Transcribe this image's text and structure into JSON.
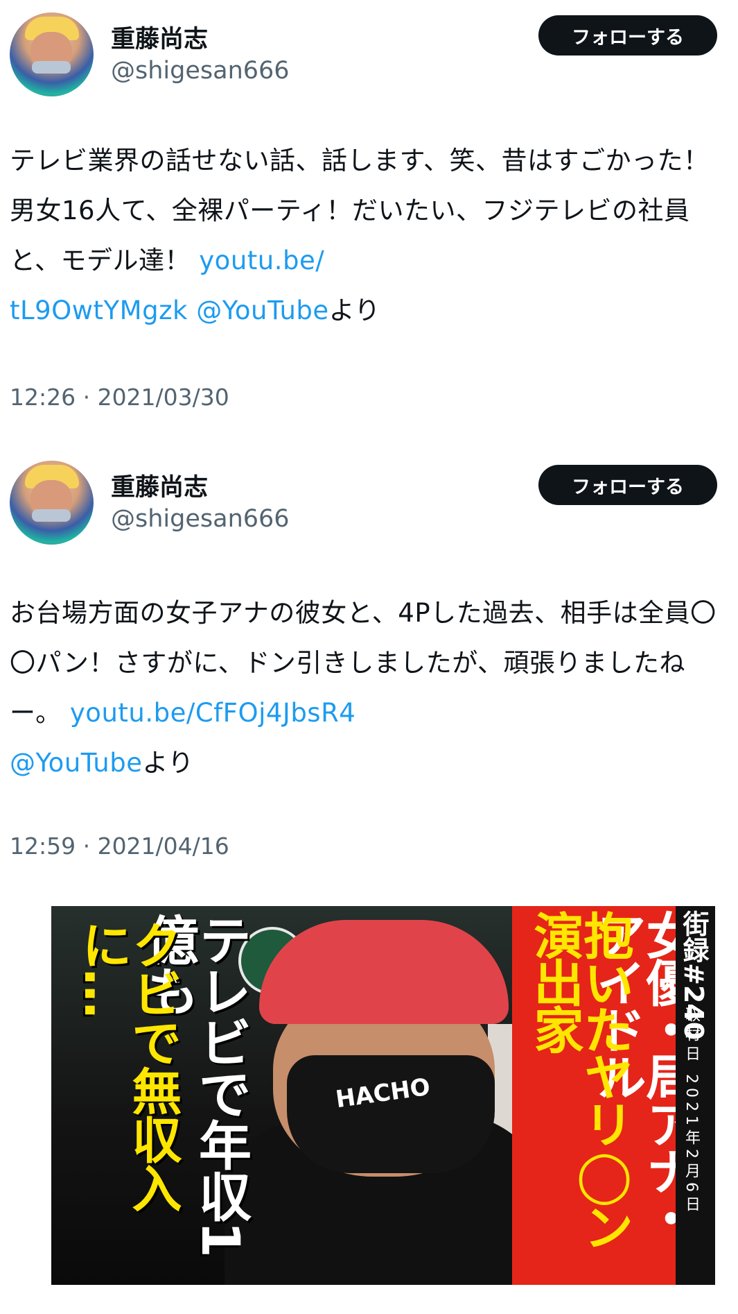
{
  "tweets": [
    {
      "author_name": "重藤尚志",
      "author_handle": "@shigesan666",
      "follow_label": "フォローする",
      "text_plain": "テレビ業界の話せない話、話します、笑、昔はすごかった！男女16人て、全裸パーティ！だいたい、フジテレビの社員と、モデル達！ ",
      "link_text": "youtu.be/\ntL9OwtYMgzk",
      "link_text_1": "youtu.be/",
      "link_text_2": "tL9OwtYMgzk",
      "mention": "@YouTube",
      "suffix": "より",
      "timestamp": "12:26 · 2021/03/30"
    },
    {
      "author_name": "重藤尚志",
      "author_handle": "@shigesan666",
      "follow_label": "フォローする",
      "text_plain": "お台場方面の女子アナの彼女と、4Pした過去、相手は全員〇〇パン！さすがに、ドン引きしましたが、頑張りましたねー。 ",
      "link_text": "youtu.be/CfFOj4JbsR4",
      "mention": "@YouTube",
      "suffix": "より",
      "timestamp": "12:59 · 2021/04/16"
    }
  ],
  "media": {
    "col_yellow": "クビで無収入に…",
    "col_white": "テレビで年収1億も",
    "col_red_white": "女優・局アナ・アイドル",
    "col_red_yellow": "抱いたヤリ◯ン演出家",
    "series_label": "街録#240",
    "date_label": "取材日 2021年2月6日",
    "mask_logo": "HACHO"
  }
}
